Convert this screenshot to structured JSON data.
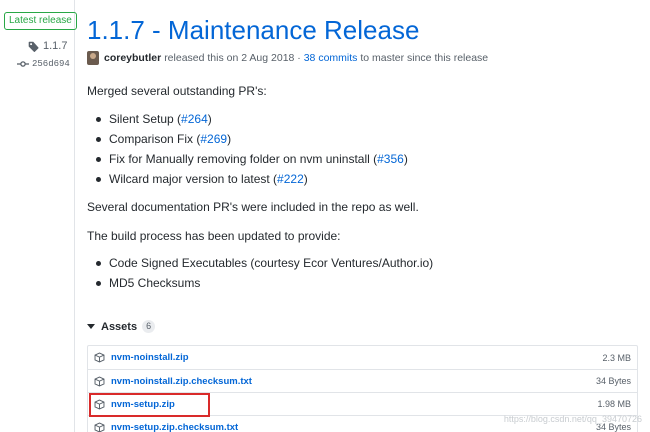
{
  "sidebar": {
    "badge": "Latest release",
    "tag": "1.1.7",
    "commit": "256d694"
  },
  "release": {
    "title": "1.1.7 - Maintenance Release",
    "author": "coreybutler",
    "released_text": "released this on 2 Aug 2018 ·",
    "commits_link": "38 commits",
    "since_text": "to master since this release"
  },
  "notes": {
    "intro": "Merged several outstanding PR's:",
    "prs": [
      {
        "text": "Silent Setup (",
        "link": "#264",
        "close": ")"
      },
      {
        "text": "Comparison Fix (",
        "link": "#269",
        "close": ")"
      },
      {
        "text": "Fix for Manually removing folder on nvm uninstall (",
        "link": "#356",
        "close": ")"
      },
      {
        "text": "Wilcard major version to latest (",
        "link": "#222",
        "close": ")"
      }
    ],
    "docs_text": "Several documentation PR's were included in the repo as well.",
    "build_text": "The build process has been updated to provide:",
    "build_items": [
      "Code Signed Executables (courtesy Ecor Ventures/Author.io)",
      "MD5 Checksums"
    ]
  },
  "assets": {
    "label": "Assets",
    "count": "6",
    "rows": [
      {
        "name": "nvm-noinstall.zip",
        "size": "2.3 MB"
      },
      {
        "name": "nvm-noinstall.zip.checksum.txt",
        "size": "34 Bytes"
      },
      {
        "name": "nvm-setup.zip",
        "size": "1.98 MB"
      },
      {
        "name": "nvm-setup.zip.checksum.txt",
        "size": "34 Bytes"
      }
    ]
  },
  "watermark": "https://blog.csdn.net/qq_39470726"
}
